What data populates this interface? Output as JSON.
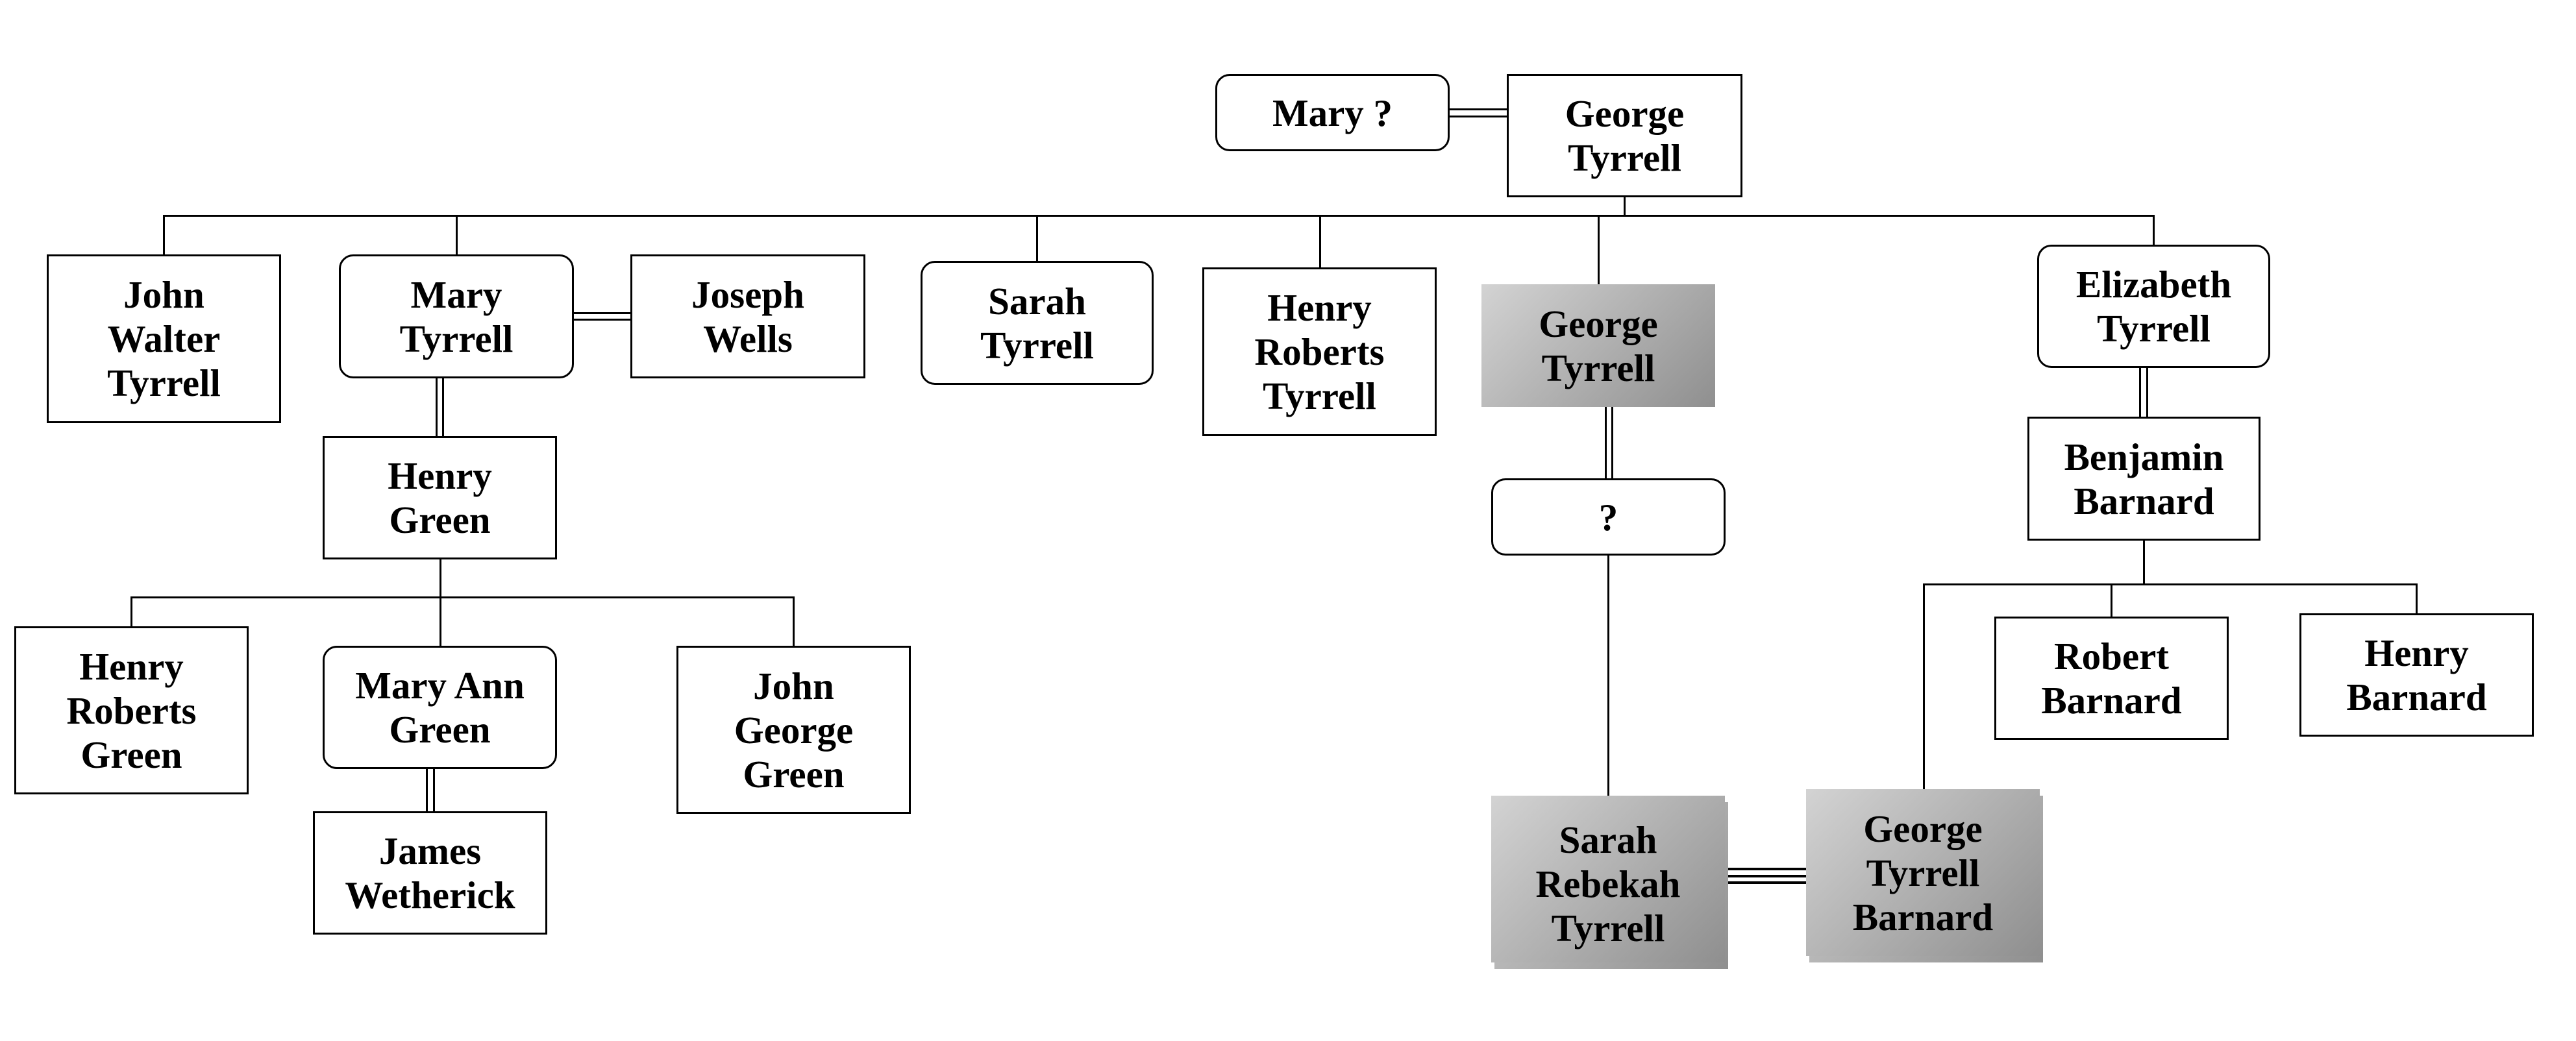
{
  "colors": {
    "background": "#ffffff",
    "line": "#000000",
    "text": "#000000",
    "highlight_gradient_start": "#d3d3d3",
    "highlight_gradient_end": "#8f8f8f"
  },
  "people": [
    {
      "id": "mary-unknown",
      "lines": [
        "Mary ?"
      ],
      "shape": "rounded",
      "highlighted": false
    },
    {
      "id": "george-tyrrell-sr",
      "lines": [
        "George",
        "Tyrrell"
      ],
      "shape": "rectangle",
      "highlighted": false
    },
    {
      "id": "john-walter-tyrrell",
      "lines": [
        "John",
        "Walter",
        "Tyrrell"
      ],
      "shape": "rectangle",
      "highlighted": false
    },
    {
      "id": "mary-tyrrell",
      "lines": [
        "Mary",
        "Tyrrell"
      ],
      "shape": "rounded",
      "highlighted": false
    },
    {
      "id": "joseph-wells",
      "lines": [
        "Joseph",
        "Wells"
      ],
      "shape": "rectangle",
      "highlighted": false
    },
    {
      "id": "sarah-tyrrell",
      "lines": [
        "Sarah",
        "Tyrrell"
      ],
      "shape": "rounded",
      "highlighted": false
    },
    {
      "id": "henry-roberts-tyrrell",
      "lines": [
        "Henry",
        "Roberts",
        "Tyrrell"
      ],
      "shape": "rectangle",
      "highlighted": false
    },
    {
      "id": "george-tyrrell-jr",
      "lines": [
        "George",
        "Tyrrell"
      ],
      "shape": "rectangle",
      "highlighted": true
    },
    {
      "id": "elizabeth-tyrrell",
      "lines": [
        "Elizabeth",
        "Tyrrell"
      ],
      "shape": "rounded",
      "highlighted": false
    },
    {
      "id": "benjamin-barnard",
      "lines": [
        "Benjamin",
        "Barnard"
      ],
      "shape": "rectangle",
      "highlighted": false
    },
    {
      "id": "unknown-spouse",
      "lines": [
        "?"
      ],
      "shape": "rounded",
      "highlighted": false
    },
    {
      "id": "henry-green",
      "lines": [
        "Henry",
        "Green"
      ],
      "shape": "rectangle",
      "highlighted": false
    },
    {
      "id": "henry-roberts-green",
      "lines": [
        "Henry",
        "Roberts",
        "Green"
      ],
      "shape": "rectangle",
      "highlighted": false
    },
    {
      "id": "mary-ann-green",
      "lines": [
        "Mary Ann",
        "Green"
      ],
      "shape": "rounded",
      "highlighted": false
    },
    {
      "id": "john-george-green",
      "lines": [
        "John",
        "George",
        "Green"
      ],
      "shape": "rectangle",
      "highlighted": false
    },
    {
      "id": "james-wetherick",
      "lines": [
        "James",
        "Wetherick"
      ],
      "shape": "rectangle",
      "highlighted": false
    },
    {
      "id": "robert-barnard",
      "lines": [
        "Robert",
        "Barnard"
      ],
      "shape": "rectangle",
      "highlighted": false
    },
    {
      "id": "henry-barnard",
      "lines": [
        "Henry",
        "Barnard"
      ],
      "shape": "rectangle",
      "highlighted": false
    },
    {
      "id": "sarah-rebekah-tyrrell",
      "lines": [
        "Sarah",
        "Rebekah",
        "Tyrrell"
      ],
      "shape": "rectangle",
      "highlighted": true
    },
    {
      "id": "george-tyrrell-barnard",
      "lines": [
        "George",
        "Tyrrell",
        "Barnard"
      ],
      "shape": "rectangle",
      "highlighted": true
    }
  ],
  "relationships": {
    "couples": [
      {
        "partners": [
          "mary-unknown",
          "george-tyrrell-sr"
        ],
        "line": "double"
      },
      {
        "partners": [
          "mary-tyrrell",
          "joseph-wells"
        ],
        "line": "double"
      },
      {
        "partners": [
          "mary-tyrrell",
          "henry-green"
        ],
        "line": "double"
      },
      {
        "partners": [
          "mary-ann-green",
          "james-wetherick"
        ],
        "line": "double"
      },
      {
        "partners": [
          "george-tyrrell-jr",
          "unknown-spouse"
        ],
        "line": "double"
      },
      {
        "partners": [
          "elizabeth-tyrrell",
          "benjamin-barnard"
        ],
        "line": "double"
      },
      {
        "partners": [
          "sarah-rebekah-tyrrell",
          "george-tyrrell-barnard"
        ],
        "line": "triple"
      }
    ],
    "descent": [
      {
        "from": "george-tyrrell-sr",
        "children": [
          "john-walter-tyrrell",
          "mary-tyrrell",
          "sarah-tyrrell",
          "henry-roberts-tyrrell",
          "george-tyrrell-jr",
          "elizabeth-tyrrell"
        ]
      },
      {
        "from": "henry-green",
        "children": [
          "henry-roberts-green",
          "mary-ann-green",
          "john-george-green"
        ]
      },
      {
        "from": "unknown-spouse",
        "children": [
          "sarah-rebekah-tyrrell"
        ]
      },
      {
        "from": "benjamin-barnard",
        "children": [
          "george-tyrrell-barnard",
          "robert-barnard",
          "henry-barnard"
        ]
      }
    ]
  }
}
